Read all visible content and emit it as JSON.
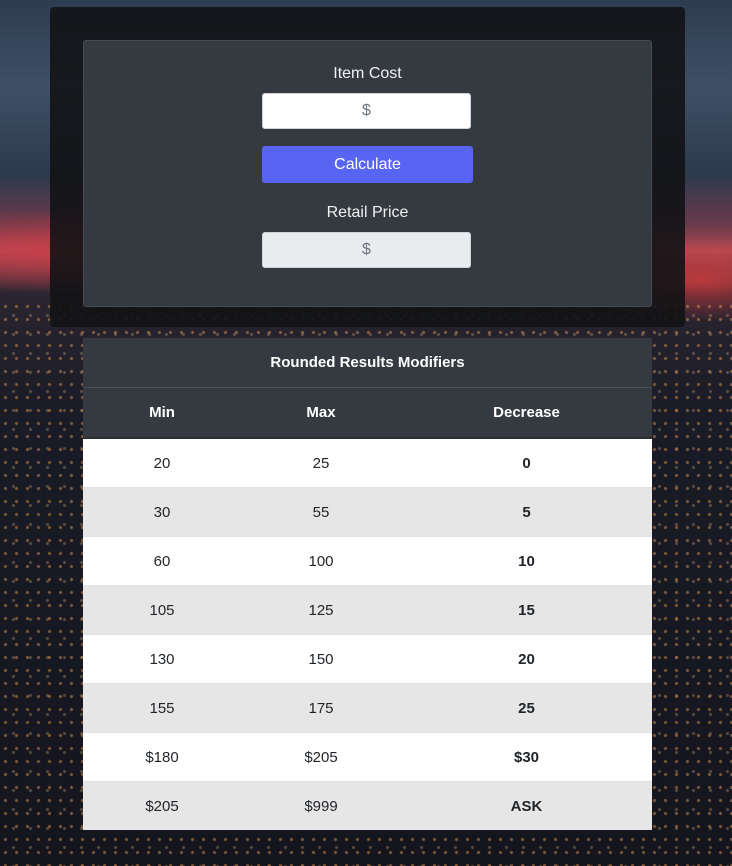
{
  "calculator": {
    "item_cost_label": "Item Cost",
    "item_cost_placeholder": "$",
    "calculate_label": "Calculate",
    "retail_price_label": "Retail Price",
    "retail_price_placeholder": "$"
  },
  "modifiers": {
    "title": "Rounded Results Modifiers",
    "columns": [
      "Min",
      "Max",
      "Decrease"
    ],
    "rows": [
      {
        "min": "20",
        "max": "25",
        "decrease": "0"
      },
      {
        "min": "30",
        "max": "55",
        "decrease": "5"
      },
      {
        "min": "60",
        "max": "100",
        "decrease": "10"
      },
      {
        "min": "105",
        "max": "125",
        "decrease": "15"
      },
      {
        "min": "130",
        "max": "150",
        "decrease": "20"
      },
      {
        "min": "155",
        "max": "175",
        "decrease": "25"
      },
      {
        "min": "$180",
        "max": "$205",
        "decrease": "$30"
      },
      {
        "min": "$205",
        "max": "$999",
        "decrease": "ASK"
      }
    ]
  }
}
